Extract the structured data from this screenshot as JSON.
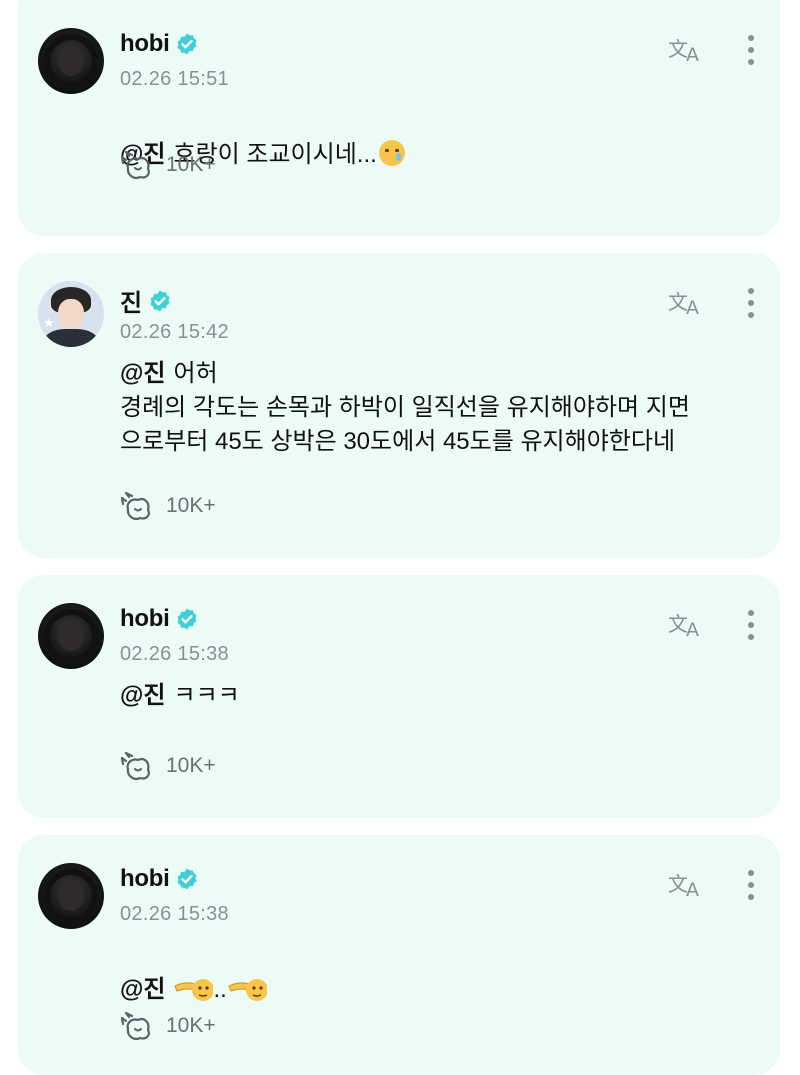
{
  "colors": {
    "card_bg": "#ecfbf6",
    "badge": "#3ed0d4",
    "meta_text": "#8a8f95"
  },
  "posts": [
    {
      "author": "hobi",
      "avatar": "hobi-avatar",
      "time": "02.26 15:51",
      "mention": "@진",
      "text": "호랑이 조교이시네...",
      "emoji": "crying-face-emoji",
      "reactions": "10K+"
    },
    {
      "author": "진",
      "avatar": "jin-avatar",
      "time": "02.26 15:42",
      "mention": "@진",
      "text": "어허\n경례의 각도는 손목과 하박이 일직선을 유지해야하며 지면\n으로부터 45도 상박은 30도에서 45도를 유지해야한다네",
      "reactions": "10K+"
    },
    {
      "author": "hobi",
      "avatar": "hobi-avatar",
      "time": "02.26 15:38",
      "mention": "@진",
      "text": "ㅋㅋㅋ",
      "reactions": "10K+"
    },
    {
      "author": "hobi",
      "avatar": "hobi-avatar",
      "time": "02.26 15:38",
      "mention": "@진",
      "text": "..",
      "emoji": "saluting-face-emoji",
      "reactions": "10K+"
    }
  ]
}
